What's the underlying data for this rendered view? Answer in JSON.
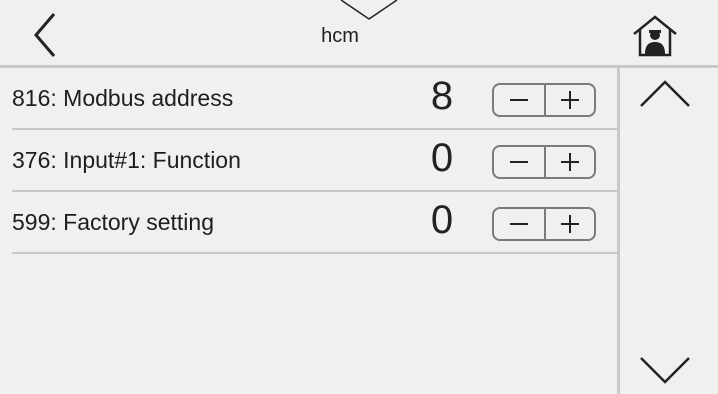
{
  "header": {
    "title": "hcm",
    "back_icon": "chevron-left-icon",
    "menu_icon": "chevron-down-tab-icon",
    "home_icon": "home-user-icon"
  },
  "parameters": [
    {
      "label": "816: Modbus address",
      "value": "8"
    },
    {
      "label": "376: Input#1: Function",
      "value": "0"
    },
    {
      "label": "599: Factory setting",
      "value": "0"
    }
  ],
  "stepper": {
    "minus_symbol": "−",
    "plus_symbol": "+"
  },
  "scroll": {
    "up_icon": "chevron-up-icon",
    "down_icon": "chevron-down-icon"
  },
  "colors": {
    "background": "#f0f0f0",
    "divider": "#c8c8c8",
    "stroke": "#222222"
  }
}
